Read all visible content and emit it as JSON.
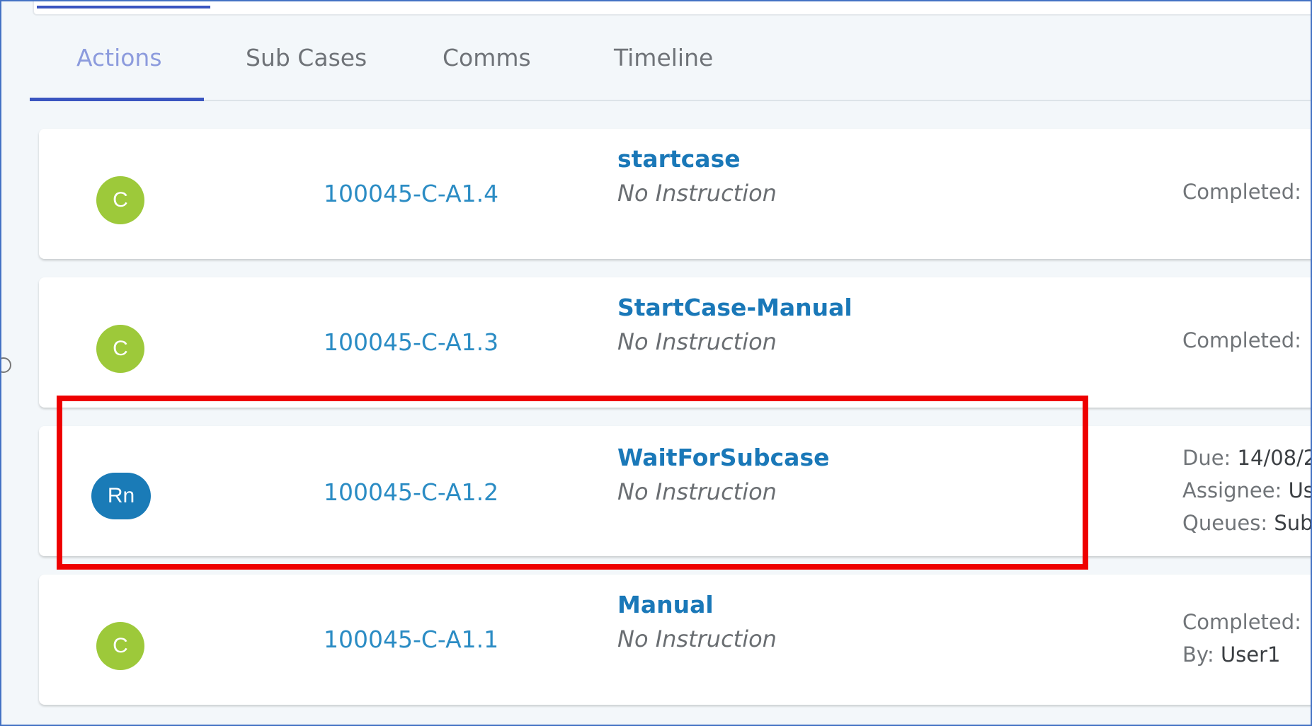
{
  "tabs": [
    {
      "label": "Actions",
      "active": true
    },
    {
      "label": "Sub Cases",
      "active": false
    },
    {
      "label": "Comms",
      "active": false
    },
    {
      "label": "Timeline",
      "active": false
    }
  ],
  "actions": [
    {
      "status": "C",
      "status_color": "#9dc93a",
      "case_id": "100045-C-A1.4",
      "name": "startcase",
      "instruction": "No Instruction",
      "meta": [
        {
          "label": "Completed:",
          "value": ""
        }
      ]
    },
    {
      "status": "C",
      "status_color": "#9dc93a",
      "case_id": "100045-C-A1.3",
      "name": "StartCase-Manual",
      "instruction": "No Instruction",
      "meta": [
        {
          "label": "Completed:",
          "value": ""
        }
      ]
    },
    {
      "status": "Rn",
      "status_color": "#1a7bb7",
      "case_id": "100045-C-A1.2",
      "name": "WaitForSubcase",
      "instruction": "No Instruction",
      "meta": [
        {
          "label": "Due:",
          "value": "14/08/2"
        },
        {
          "label": "Assignee:",
          "value": "Use"
        },
        {
          "label": "Queues:",
          "value": "Sub"
        }
      ]
    },
    {
      "status": "C",
      "status_color": "#9dc93a",
      "case_id": "100045-C-A1.1",
      "name": "Manual",
      "instruction": "No Instruction",
      "meta": [
        {
          "label": "Completed:",
          "value": ""
        },
        {
          "label": "By:",
          "value": "User1"
        }
      ]
    }
  ],
  "colors": {
    "accent": "#3a55c0",
    "link": "#2b8cc4",
    "action_name": "#1a78b8",
    "highlight": "#ee0000"
  }
}
